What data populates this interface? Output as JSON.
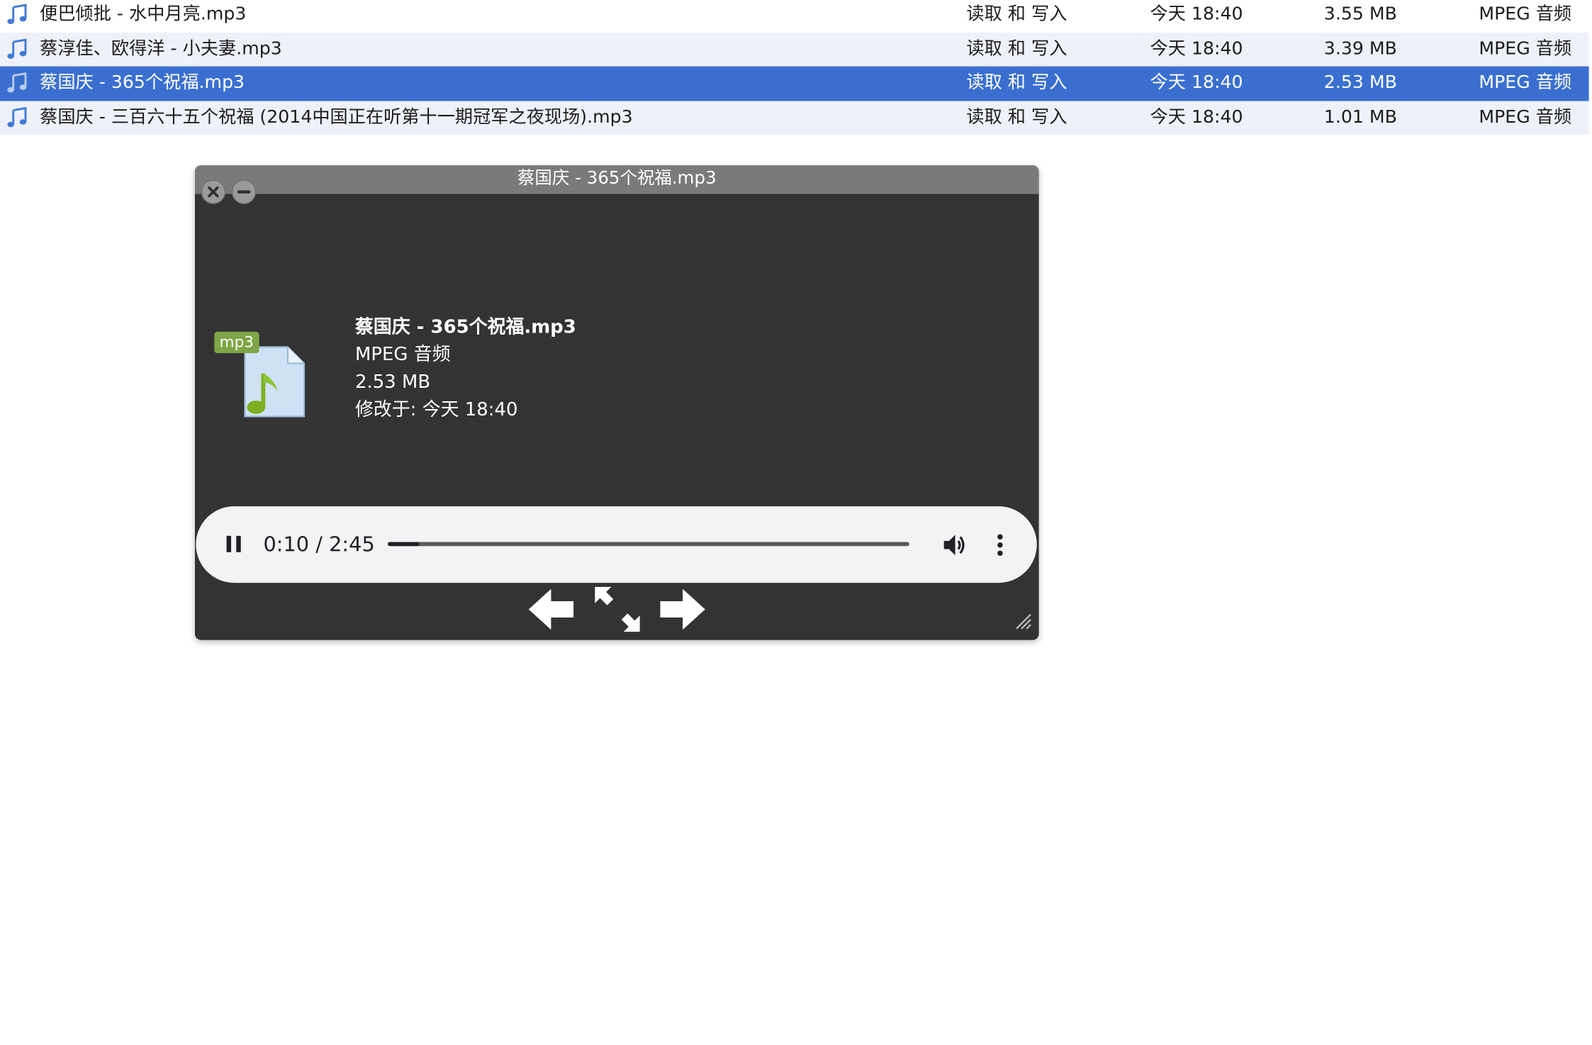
{
  "file_list": {
    "rows": [
      {
        "name": "便巴倾批 - 水中月亮.mp3",
        "permission": "读取 和 写入",
        "modified": "今天 18:40",
        "size": "3.55 MB",
        "kind": "MPEG 音频",
        "selected": false
      },
      {
        "name": "蔡淳佳、欧得洋 - 小夫妻.mp3",
        "permission": "读取 和 写入",
        "modified": "今天 18:40",
        "size": "3.39 MB",
        "kind": "MPEG 音频",
        "selected": false
      },
      {
        "name": "蔡国庆 - 365个祝福.mp3",
        "permission": "读取 和 写入",
        "modified": "今天 18:40",
        "size": "2.53 MB",
        "kind": "MPEG 音频",
        "selected": true
      },
      {
        "name": "蔡国庆 - 三百六十五个祝福 (2014中国正在听第十一期冠军之夜现场).mp3",
        "permission": "读取 和 写入",
        "modified": "今天 18:40",
        "size": "1.01 MB",
        "kind": "MPEG 音频",
        "selected": false
      }
    ],
    "icon": "music-note-icon"
  },
  "viewer": {
    "title": "蔡国庆 - 365个祝福.mp3",
    "badge": "mp3",
    "info": {
      "title": "蔡国庆 - 365个祝福.mp3",
      "kind": "MPEG 音频",
      "size": "2.53 MB",
      "modified": "修改于: 今天 18:40"
    },
    "player": {
      "time": "0:10 / 2:45",
      "progress": 0.0606,
      "state": "playing"
    },
    "icons": {
      "close": "close-icon",
      "minimize": "minimize-icon",
      "pause": "pause-icon",
      "volume": "volume-icon",
      "more": "more-vertical-icon",
      "prev": "arrow-left-icon",
      "fullscreen": "fullscreen-icon",
      "next": "arrow-right-icon",
      "resize": "resize-grip-icon"
    }
  },
  "colors": {
    "selection": "#3a6fd0",
    "alt_row": "#eef1fa",
    "viewer_bg": "#333333",
    "titlebar": "#7a7a7a",
    "badge": "#7ea547"
  }
}
